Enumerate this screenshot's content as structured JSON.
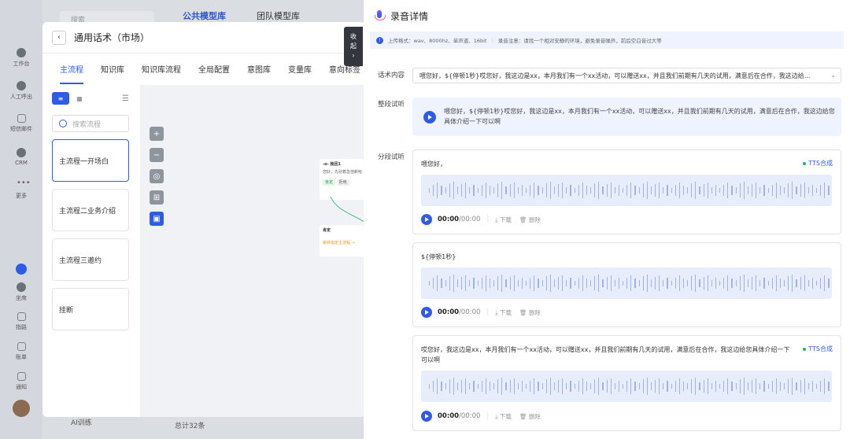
{
  "rail": {
    "items": [
      {
        "label": "工作台",
        "icon": "workbench-icon"
      },
      {
        "label": "人工呼出",
        "icon": "manual-call-icon"
      },
      {
        "label": "短信邮件",
        "icon": "sms-icon"
      },
      {
        "label": "CRM",
        "icon": "crm-icon"
      },
      {
        "label": "更多",
        "icon": "more-icon"
      },
      {
        "label": "坐席",
        "icon": "agent-icon"
      },
      {
        "label": "指路",
        "icon": "route-icon"
      },
      {
        "label": "账单",
        "icon": "bill-icon"
      },
      {
        "label": "通知",
        "icon": "bell-icon"
      }
    ]
  },
  "background": {
    "search_placeholder": "搜索",
    "tabs": [
      "公共模型库",
      "团队模型库"
    ],
    "bottom_item": "AI训练",
    "total": "总计32条"
  },
  "modal": {
    "title": "通用话术（市场）",
    "tabs": [
      "主流程",
      "知识库",
      "知识库流程",
      "全局配置",
      "意图库",
      "变量库",
      "意向标签"
    ],
    "search_placeholder": "搜索流程",
    "flows": [
      "主流程一开场白",
      "主流程二业务介绍",
      "主流程三邀约",
      "挂断"
    ],
    "collapse_label": [
      "收",
      "起",
      "›"
    ],
    "node1": {
      "title": "-o- 挽回1",
      "text": "您好，先别着急挂断哈",
      "chips": [
        "肯定",
        "拒绝"
      ]
    },
    "node2": {
      "title": "肯定",
      "text": "跳转指定主流程 →"
    }
  },
  "drawer": {
    "title": "录音详情",
    "notice_format": "上传格式：wav、8000hz、单声道、16bit",
    "notice_tip": "录音注意：请找一个相对安静的环境，避免录音噪声，前后空白音过大等",
    "labels": {
      "content": "话术内容",
      "whole": "整段试听",
      "segment": "分段试听"
    },
    "content_value": "喂您好，${停顿1秒}哎您好，我这边是xx，本月我们有一个xx活动，可以赠送xx，并且我们前期有几天的试用，满意后在合作，我这边给...",
    "whole_text": "喂您好，${停顿1秒}哎您好，我这边是xx，本月我们有一个xx活动，可以赠送xx，并且我们前期有几天的试用，满意后在合作，我这边给您具体介绍一下可以啊",
    "segments": [
      {
        "text": "喂您好，",
        "tag": "TTS合成",
        "time": "00:00",
        "total": "/00:00"
      },
      {
        "text": "${停顿1秒}",
        "tag": "",
        "time": "00:00",
        "total": "/00:00"
      },
      {
        "text": "哎您好，我这边是xx，本月我们有一个xx活动，可以赠送xx，并且我们前期有几天的试用，满意后在合作，我这边给您具体介绍一下可以啊",
        "tag": "TTS合成",
        "time": "00:00",
        "total": "/00:00"
      }
    ],
    "actions": {
      "download": "下载",
      "delete": "删除"
    }
  },
  "colors": {
    "accent": "#2f5ce6",
    "tts_dot": "#22b35e",
    "wave_bg": "#e7edfb"
  }
}
